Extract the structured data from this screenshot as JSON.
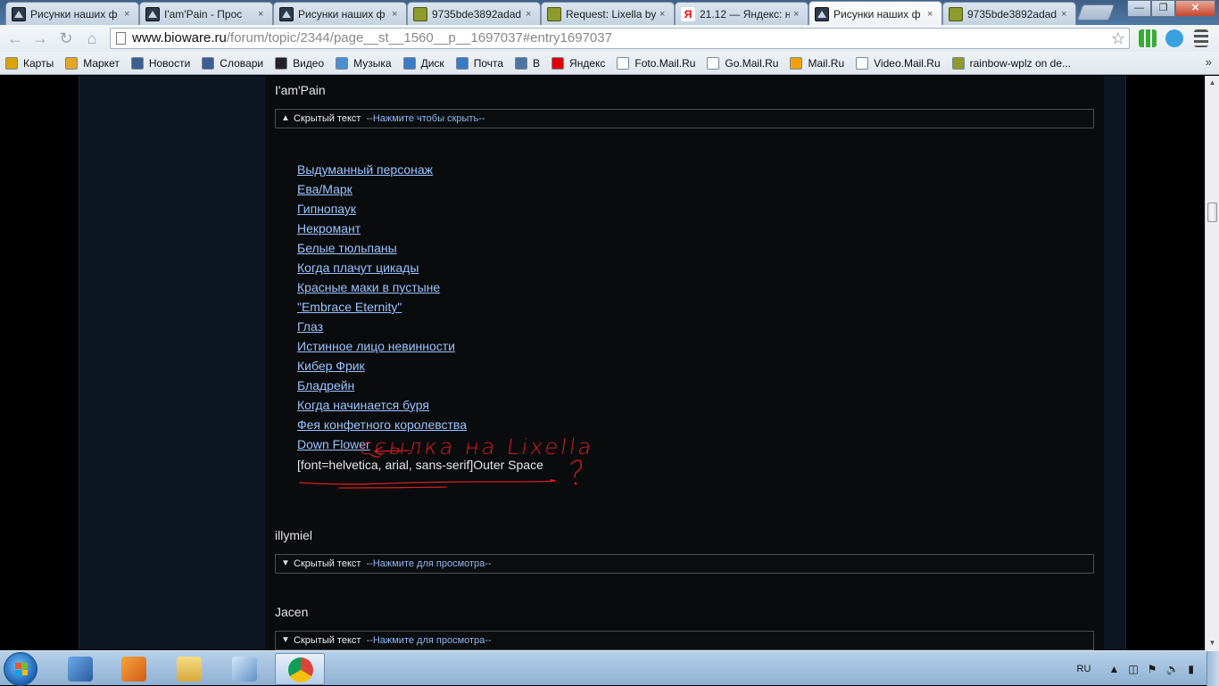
{
  "browser": {
    "tabs": [
      {
        "title": "Рисунки наших ф",
        "favicon": "bioware-icon",
        "active": false
      },
      {
        "title": "I'am'Pain - Прос",
        "favicon": "bioware-icon",
        "active": false
      },
      {
        "title": "Рисунки наших ф",
        "favicon": "bioware-icon",
        "active": false
      },
      {
        "title": "9735bde3892adad",
        "favicon": "image-icon",
        "active": false
      },
      {
        "title": "Request: Lixella by",
        "favicon": "image-icon",
        "active": false
      },
      {
        "title": "21.12 — Яндекс: н",
        "favicon": "yandex-icon",
        "active": false
      },
      {
        "title": "Рисунки наших ф",
        "favicon": "bioware-icon",
        "active": true
      },
      {
        "title": "9735bde3892adad",
        "favicon": "image-icon",
        "active": false
      }
    ],
    "close_glyph": "×",
    "window_controls": {
      "minimize": "—",
      "maximize": "❐",
      "close": "✕"
    },
    "url_host": "www.bioware.ru",
    "url_path": "/forum/topic/2344/page__st__1560__p__1697037#entry1697037",
    "bookmarks": [
      {
        "label": "Карты",
        "color": "#d9a400"
      },
      {
        "label": "Маркет",
        "color": "#e2a623"
      },
      {
        "label": "Новости",
        "color": "#3d5f8f"
      },
      {
        "label": "Словари",
        "color": "#3d5f8f"
      },
      {
        "label": "Видео",
        "color": "#222222"
      },
      {
        "label": "Музыка",
        "color": "#4a8fcf"
      },
      {
        "label": "Диск",
        "color": "#3b7ac5"
      },
      {
        "label": "Почта",
        "color": "#3b7ac5"
      },
      {
        "label": "В",
        "color": "#4c75a3"
      },
      {
        "label": "Яндекс",
        "color": "#e00000"
      },
      {
        "label": "Foto.Mail.Ru",
        "color": "#ffffff"
      },
      {
        "label": "Go.Mail.Ru",
        "color": "#ffffff"
      },
      {
        "label": "Mail.Ru",
        "color": "#f5a000"
      },
      {
        "label": "Video.Mail.Ru",
        "color": "#ffffff"
      },
      {
        "label": "rainbow-wplz on de...",
        "color": "#8d9a2c"
      }
    ],
    "bookmarks_more": "»"
  },
  "post": {
    "author1": "I'am'Pain",
    "spoiler1": {
      "label": "Скрытый текст",
      "action": "--Нажмите чтобы скрыть--",
      "chevron": "^"
    },
    "links": [
      "Выдуманный персонаж",
      "Ева/Марк",
      "Гипнопаук",
      "Некромант",
      "Белые тюльпаны",
      "Когда плачут цикады",
      "Красные маки в пустыне",
      "\"Embrace Eternity\"",
      "Глаз",
      "Истинное лицо невинности",
      "Кибер Фрик",
      "Бладрейн",
      "Когда начинается буря",
      "Фея конфетного королевства",
      "Down Flower"
    ],
    "raw_line": "[font=helvetica, arial, sans-serif]Outer Space",
    "annotation_text": "ссылка на Lixella",
    "annotation_question": "?",
    "author2": "illymiel",
    "spoiler2": {
      "label": "Скрытый текст",
      "action": "--Нажмите для просмотра--",
      "chevron": "v"
    },
    "author3": "Jacen",
    "spoiler3": {
      "label": "Скрытый текст",
      "action": "--Нажмите для просмотра--",
      "chevron": "v"
    }
  },
  "colors": {
    "link": "#9cc4ff",
    "annotation": "#d42020",
    "accent_blue": "#4f78a6"
  },
  "taskbar": {
    "language": "RU"
  }
}
